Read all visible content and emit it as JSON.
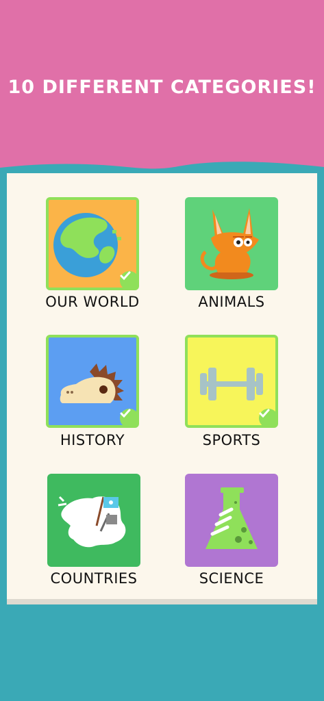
{
  "headline": "10 DIFFERENT CATEGORIES!",
  "colors": {
    "header_pink": "#e070a8",
    "wave_teal": "#3aa9b6",
    "panel_bg": "#fcf7ec",
    "completed_border": "#8fe05a"
  },
  "categories": [
    {
      "label": "OUR WORLD",
      "icon": "globe-icon",
      "bg": "#fbb448",
      "completed": true
    },
    {
      "label": "ANIMALS",
      "icon": "fox-icon",
      "bg": "#5fd27a",
      "completed": false
    },
    {
      "label": "HISTORY",
      "icon": "dinosaur-icon",
      "bg": "#5c9ef2",
      "completed": true
    },
    {
      "label": "SPORTS",
      "icon": "dumbbell-icon",
      "bg": "#f7f55a",
      "completed": true
    },
    {
      "label": "COUNTRIES",
      "icon": "antarctica-flag-icon",
      "bg": "#3fba5f",
      "completed": false
    },
    {
      "label": "SCIENCE",
      "icon": "flask-icon",
      "bg": "#b076d2",
      "completed": false
    }
  ]
}
